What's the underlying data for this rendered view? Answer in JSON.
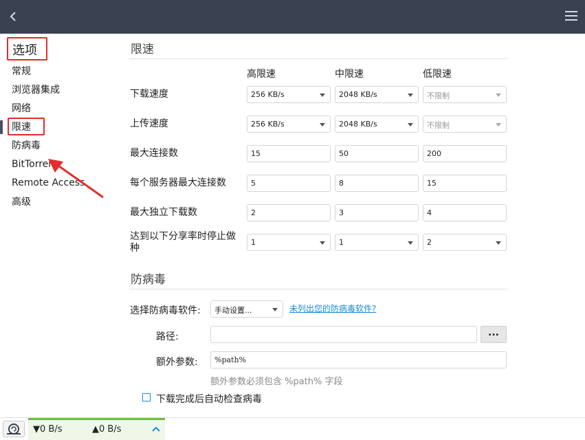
{
  "sidebar": {
    "title": "选项",
    "items": [
      {
        "label": "常规"
      },
      {
        "label": "浏览器集成"
      },
      {
        "label": "网络"
      },
      {
        "label": "限速"
      },
      {
        "label": "防病毒"
      },
      {
        "label": "BitTorrent"
      },
      {
        "label": "Remote Access"
      },
      {
        "label": "高级"
      }
    ],
    "active": "限速"
  },
  "speed_limit": {
    "title": "限速",
    "columns": [
      "高限速",
      "中限速",
      "低限速"
    ],
    "rows": [
      {
        "label": "下载速度",
        "type": "select",
        "values": [
          "256 KB/s",
          "2048 KB/s",
          "不限制"
        ]
      },
      {
        "label": "上传速度",
        "type": "select",
        "values": [
          "256 KB/s",
          "2048 KB/s",
          "不限制"
        ]
      },
      {
        "label": "最大连接数",
        "type": "input",
        "values": [
          "15",
          "50",
          "200"
        ]
      },
      {
        "label": "每个服务器最大连接数",
        "type": "input",
        "values": [
          "5",
          "8",
          "15"
        ]
      },
      {
        "label": "最大独立下载数",
        "type": "input",
        "values": [
          "2",
          "3",
          "4"
        ]
      },
      {
        "label": "达到以下分享率时停止做种",
        "type": "select",
        "values": [
          "1",
          "1",
          "2"
        ]
      }
    ]
  },
  "antivirus": {
    "title": "防病毒",
    "select_label": "选择防病毒软件:",
    "select_value": "手动设置...",
    "link": "未列出您的防病毒软件?",
    "path_label": "路径:",
    "path_value": "",
    "browse_label": "...",
    "args_label": "额外参数:",
    "args_value": "%path%",
    "hint": "额外参数必须包含 %path% 字段",
    "auto_check_label": "下载完成后自动检查病毒",
    "auto_check": false
  },
  "statusbar": {
    "download_speed": "▼0 B/s",
    "upload_speed": "▲0 B/s"
  },
  "colors": {
    "titlebar": "#3a4151",
    "annotation_red": "#e52b2b",
    "link_blue": "#1a8bd6",
    "status_green": "#6bbf3a"
  }
}
